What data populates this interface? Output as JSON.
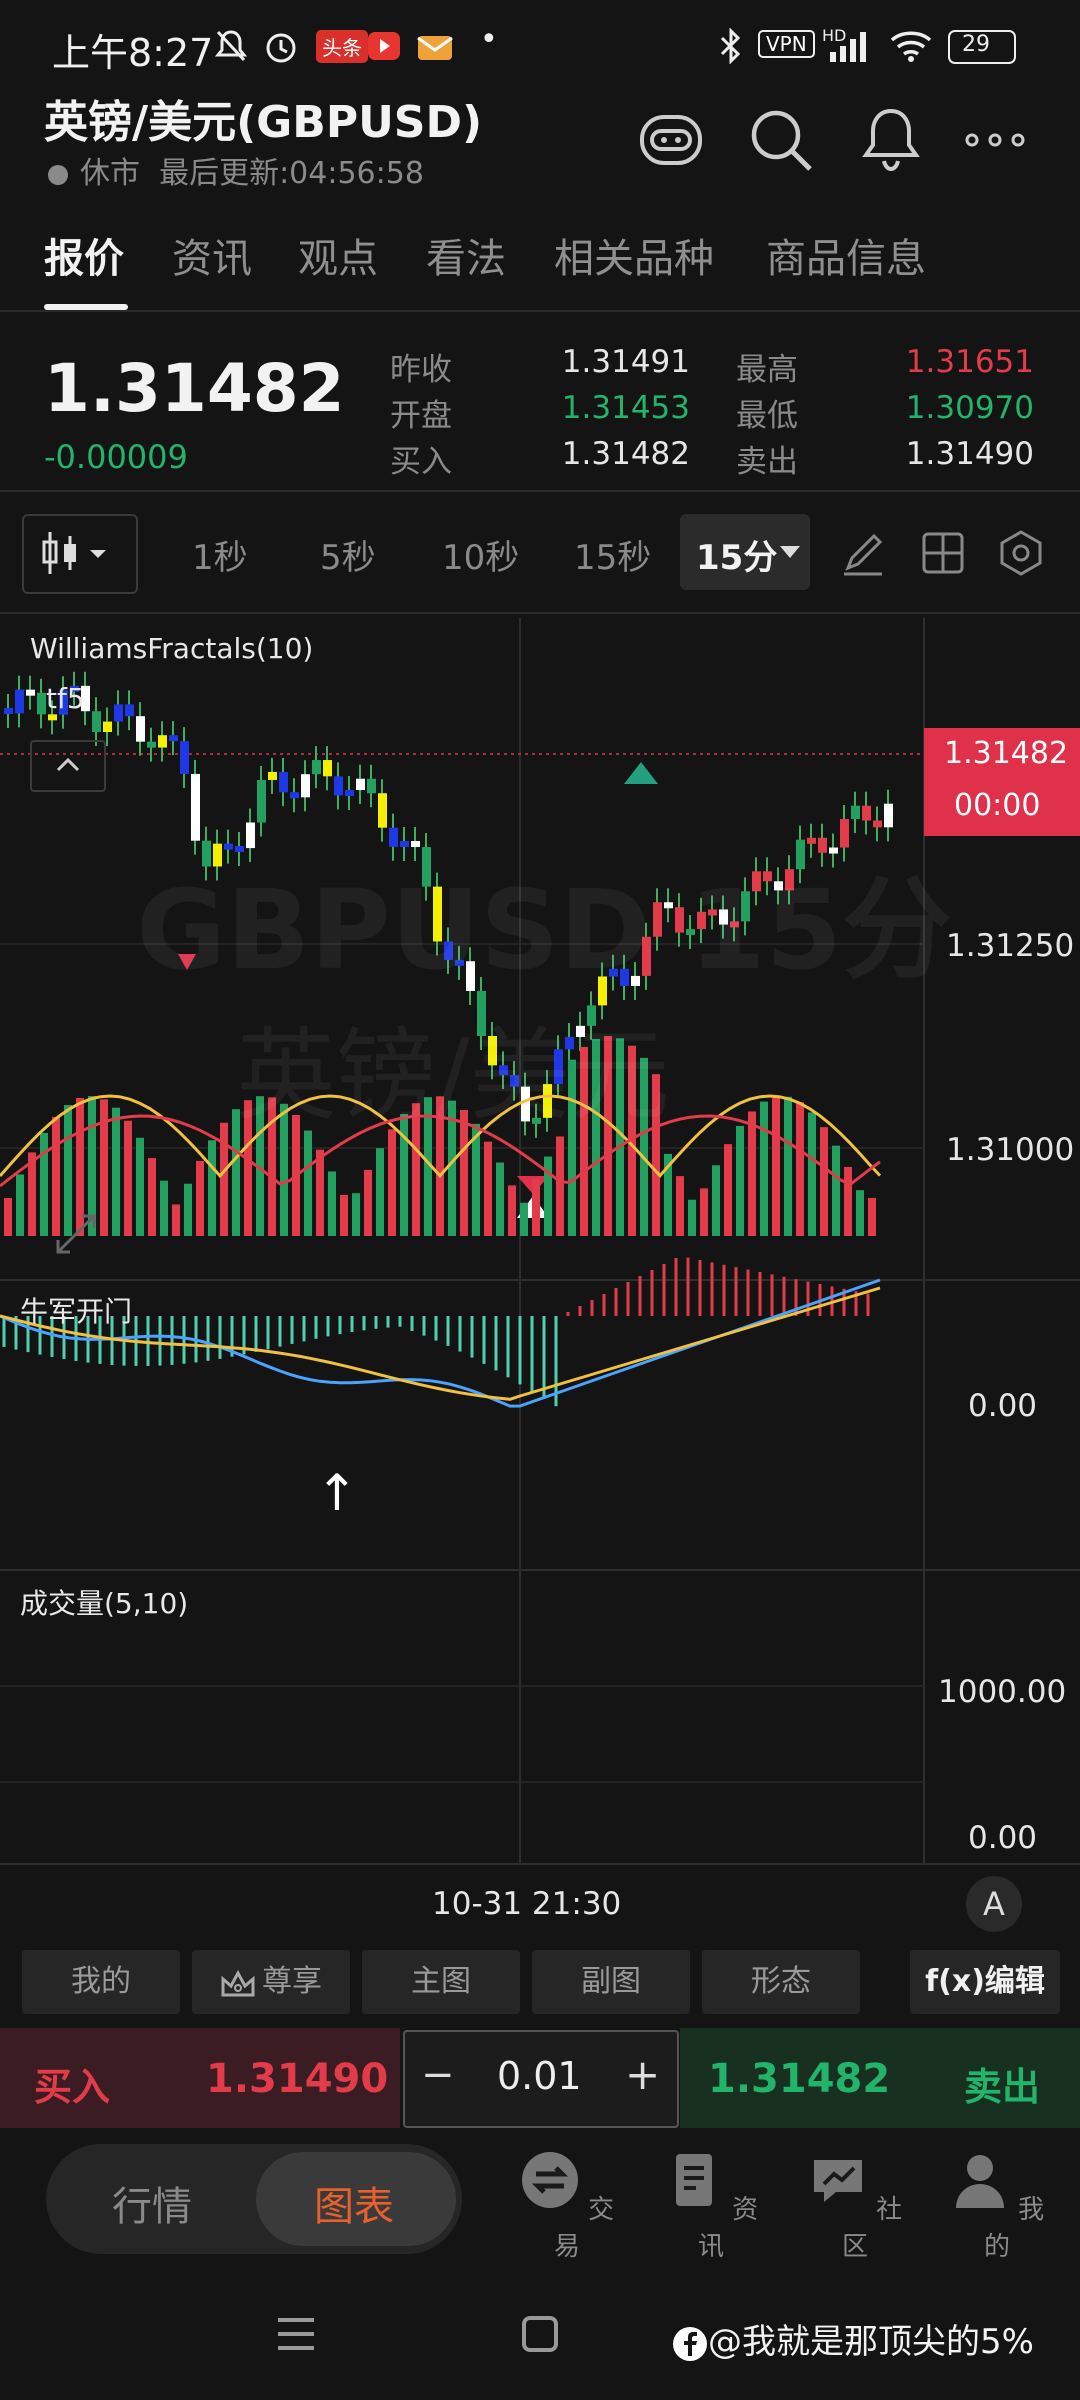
{
  "status_bar": {
    "time": "上午8:27",
    "notif_badge": "头条",
    "vpn": "VPN",
    "hd": "HD",
    "battery": "29"
  },
  "header": {
    "title": "英镑/美元(GBPUSD)",
    "market_status": "休市",
    "last_update_label": "最后更新:04:56:58"
  },
  "tabs": [
    {
      "label": "报价",
      "active": true
    },
    {
      "label": "资讯",
      "active": false
    },
    {
      "label": "观点",
      "active": false
    },
    {
      "label": "看法",
      "active": false
    },
    {
      "label": "相关品种",
      "active": false
    },
    {
      "label": "商品信息",
      "active": false
    }
  ],
  "quote": {
    "price": "1.31482",
    "change": "-0.00009",
    "prev_close_label": "昨收",
    "prev_close": "1.31491",
    "open_label": "开盘",
    "open": "1.31453",
    "bid_label": "买入",
    "bid": "1.31482",
    "high_label": "最高",
    "high": "1.31651",
    "low_label": "最低",
    "low": "1.30970",
    "ask_label": "卖出",
    "ask": "1.31490"
  },
  "toolbar": {
    "intervals": [
      "1秒",
      "5秒",
      "10秒",
      "15秒"
    ],
    "selected_interval": "15分"
  },
  "chart": {
    "indicator_label": "WilliamsFractals(10)",
    "sub_label": "tf5",
    "watermark_symbol": "GBPUSD 15分",
    "watermark_name": "英镑/美元",
    "current_price_tag": "1.31482",
    "countdown_tag": "00:00",
    "price_ticks": [
      "1.31250",
      "1.31000"
    ],
    "osc_label": "牛军开门",
    "osc_zero": "0.00",
    "osc_arrow": "↑",
    "volume_label": "成交量(5,10)",
    "volume_ticks": [
      "1000.00",
      "0.00"
    ],
    "crosshair_time": "10-31 21:30",
    "auto_btn": "A",
    "colors": {
      "up": "#e23b4a",
      "down": "#22a060",
      "blue": "#1e38e6",
      "yellow": "#f5f000",
      "ma_yellow": "#f0c040",
      "ma_blue": "#4aa3ff",
      "teal_hist": "#4fd1b0"
    }
  },
  "bottom_tools": [
    "我的",
    "尊享",
    "主图",
    "副图",
    "形态",
    "f(x)编辑"
  ],
  "trade": {
    "buy_label": "买入",
    "buy_price": "1.31490",
    "qty": "0.01",
    "minus": "−",
    "plus": "+",
    "sell_price": "1.31482",
    "sell_label": "卖出"
  },
  "nav": {
    "seg_left": "行情",
    "seg_right": "图表",
    "items": [
      "交易",
      "资讯",
      "社区",
      "我的"
    ]
  },
  "watermark_footer": "@我就是那顶尖的5%"
}
